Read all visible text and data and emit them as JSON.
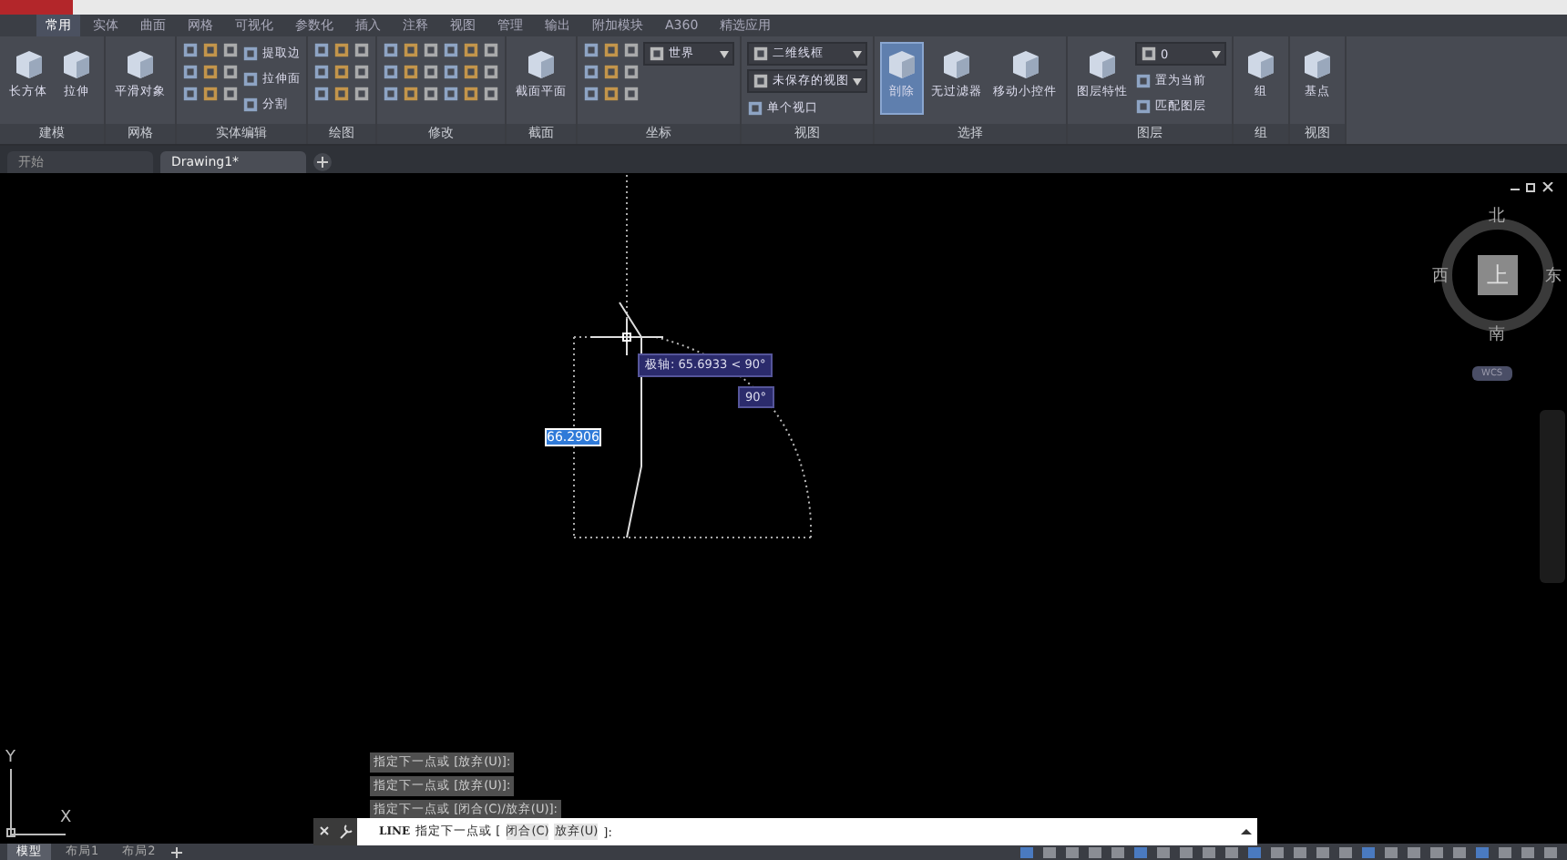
{
  "ribbon_tabs": [
    {
      "label": "常用",
      "selected": true
    },
    {
      "label": "实体",
      "selected": false
    },
    {
      "label": "曲面",
      "selected": false
    },
    {
      "label": "网格",
      "selected": false
    },
    {
      "label": "可视化",
      "selected": false
    },
    {
      "label": "参数化",
      "selected": false
    },
    {
      "label": "插入",
      "selected": false
    },
    {
      "label": "注释",
      "selected": false
    },
    {
      "label": "视图",
      "selected": false
    },
    {
      "label": "管理",
      "selected": false
    },
    {
      "label": "输出",
      "selected": false
    },
    {
      "label": "附加模块",
      "selected": false
    },
    {
      "label": "A360",
      "selected": false
    },
    {
      "label": "精选应用",
      "selected": false
    }
  ],
  "ribbon_panels": [
    {
      "label": "建模",
      "tools": [
        {
          "kind": "large",
          "label": "长方体",
          "active": false
        },
        {
          "kind": "large",
          "label": "拉伸",
          "active": false
        }
      ]
    },
    {
      "label": "网格",
      "tools": [
        {
          "kind": "large",
          "label": "平滑对象",
          "active": false
        }
      ]
    },
    {
      "label": "实体编辑",
      "tools": [
        {
          "kind": "icons",
          "active": false
        },
        {
          "kind": "stack",
          "items": [
            "提取边",
            "拉伸面",
            "分割"
          ],
          "active": false
        }
      ]
    },
    {
      "label": "绘图",
      "tools": [
        {
          "kind": "icons",
          "active": false
        }
      ]
    },
    {
      "label": "修改",
      "tools": [
        {
          "kind": "icons",
          "active": false
        },
        {
          "kind": "icons",
          "active": false
        }
      ]
    },
    {
      "label": "截面",
      "tools": [
        {
          "kind": "large",
          "label": "截面平面",
          "active": false
        }
      ]
    },
    {
      "label": "坐标",
      "tools": [
        {
          "kind": "icons",
          "active": false
        },
        {
          "kind": "dropdown",
          "label": "世界",
          "active": false
        }
      ]
    },
    {
      "label": "视图",
      "tools": [
        {
          "kind": "dropdown",
          "label": "二维线框",
          "active": false
        },
        {
          "kind": "dropdown",
          "label": "未保存的视图",
          "active": false
        },
        {
          "kind": "small",
          "label": "单个视口",
          "active": false
        }
      ]
    },
    {
      "label": "选择",
      "tools": [
        {
          "kind": "large",
          "label": "剖除",
          "active": true
        },
        {
          "kind": "large",
          "label": "无过滤器",
          "active": false
        },
        {
          "kind": "large",
          "label": "移动小控件",
          "active": false
        }
      ]
    },
    {
      "label": "图层",
      "tools": [
        {
          "kind": "large",
          "label": "图层特性",
          "active": false
        },
        {
          "kind": "dropdown",
          "label": "0",
          "active": false
        },
        {
          "kind": "stack",
          "items": [
            "置为当前",
            "匹配图层"
          ],
          "active": false
        }
      ]
    },
    {
      "label": "组",
      "tools": [
        {
          "kind": "large",
          "label": "组",
          "active": false
        }
      ]
    },
    {
      "label": "视图",
      "tools": [
        {
          "kind": "large",
          "label": "基点",
          "active": false
        }
      ]
    }
  ],
  "file_tabs": [
    {
      "label": "开始",
      "selected": false
    },
    {
      "label": "Drawing1*",
      "selected": true
    }
  ],
  "viewcube": {
    "north": "北",
    "west": "西",
    "top": "上",
    "east": "东",
    "south": "南",
    "ucs": "WCS"
  },
  "canvas": {
    "polar_tooltip": "极轴: 65.6933 < 90°",
    "angle_tooltip": "90°",
    "distance_input": "66.2906"
  },
  "ucs_axes": {
    "y": "Y",
    "x": "X"
  },
  "command_history": [
    "指定下一点或 [放弃(U)]:",
    "指定下一点或 [放弃(U)]:",
    "指定下一点或 [闭合(C)/放弃(U)]:"
  ],
  "command_line": {
    "command": "LINE",
    "prompt": "指定下一点或 [",
    "option_1": "闭合(C)",
    "option_2": "放弃(U)",
    "end": "]:"
  },
  "layout_tabs": [
    {
      "label": "模型",
      "selected": true
    },
    {
      "label": "布局1",
      "selected": false
    },
    {
      "label": "布局2",
      "selected": false
    }
  ]
}
